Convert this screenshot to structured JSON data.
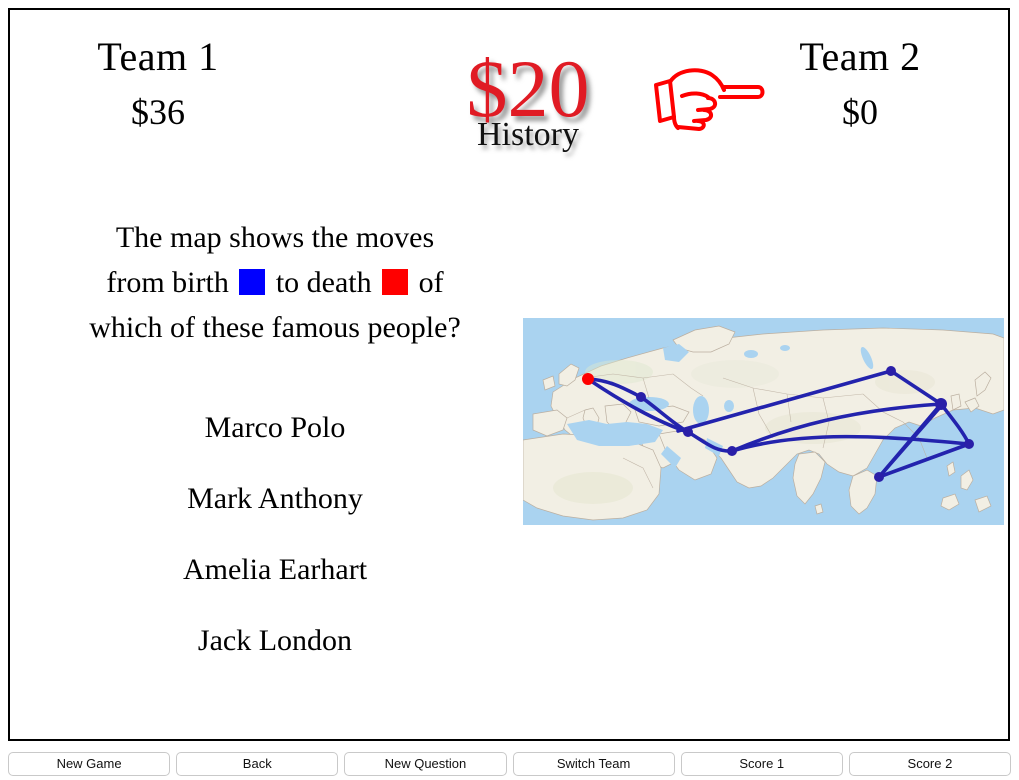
{
  "header": {
    "team1": {
      "name": "Team 1",
      "score": "$36"
    },
    "team2": {
      "name": "Team 2",
      "score": "$0"
    },
    "question_value": "$20",
    "category": "History",
    "active_team_pointer_icon": "pointing-hand-right-icon",
    "pointer_color": "#FF0000",
    "value_color": "#E01B24"
  },
  "question": {
    "line1": "The map shows the moves",
    "line2_part1": "from birth",
    "line2_part2": "to death",
    "line2_part3": "of",
    "line3": "which of these famous people?",
    "birth_swatch_color": "#0000FF",
    "death_swatch_color": "#FF0000",
    "birth_swatch_label": "birth-color-swatch",
    "death_swatch_label": "death-color-swatch"
  },
  "answers": [
    {
      "label": "Marco Polo"
    },
    {
      "label": "Mark Anthony"
    },
    {
      "label": "Amelia Earhart"
    },
    {
      "label": "Jack London"
    }
  ],
  "map": {
    "alt": "World map of Eurasia showing travel route from birth to death",
    "route_line_color": "#2020B0",
    "waypoint_color": "#2A1FA8",
    "death_marker_color": "#FF0000",
    "land_color": "#F2EFE4",
    "water_color": "#AAD3F0",
    "border_color": "#BBAFA0"
  },
  "toolbar": {
    "buttons": [
      {
        "label": "New Game"
      },
      {
        "label": "Back"
      },
      {
        "label": "New Question"
      },
      {
        "label": "Switch Team"
      },
      {
        "label": "Score 1"
      },
      {
        "label": "Score 2"
      }
    ]
  }
}
